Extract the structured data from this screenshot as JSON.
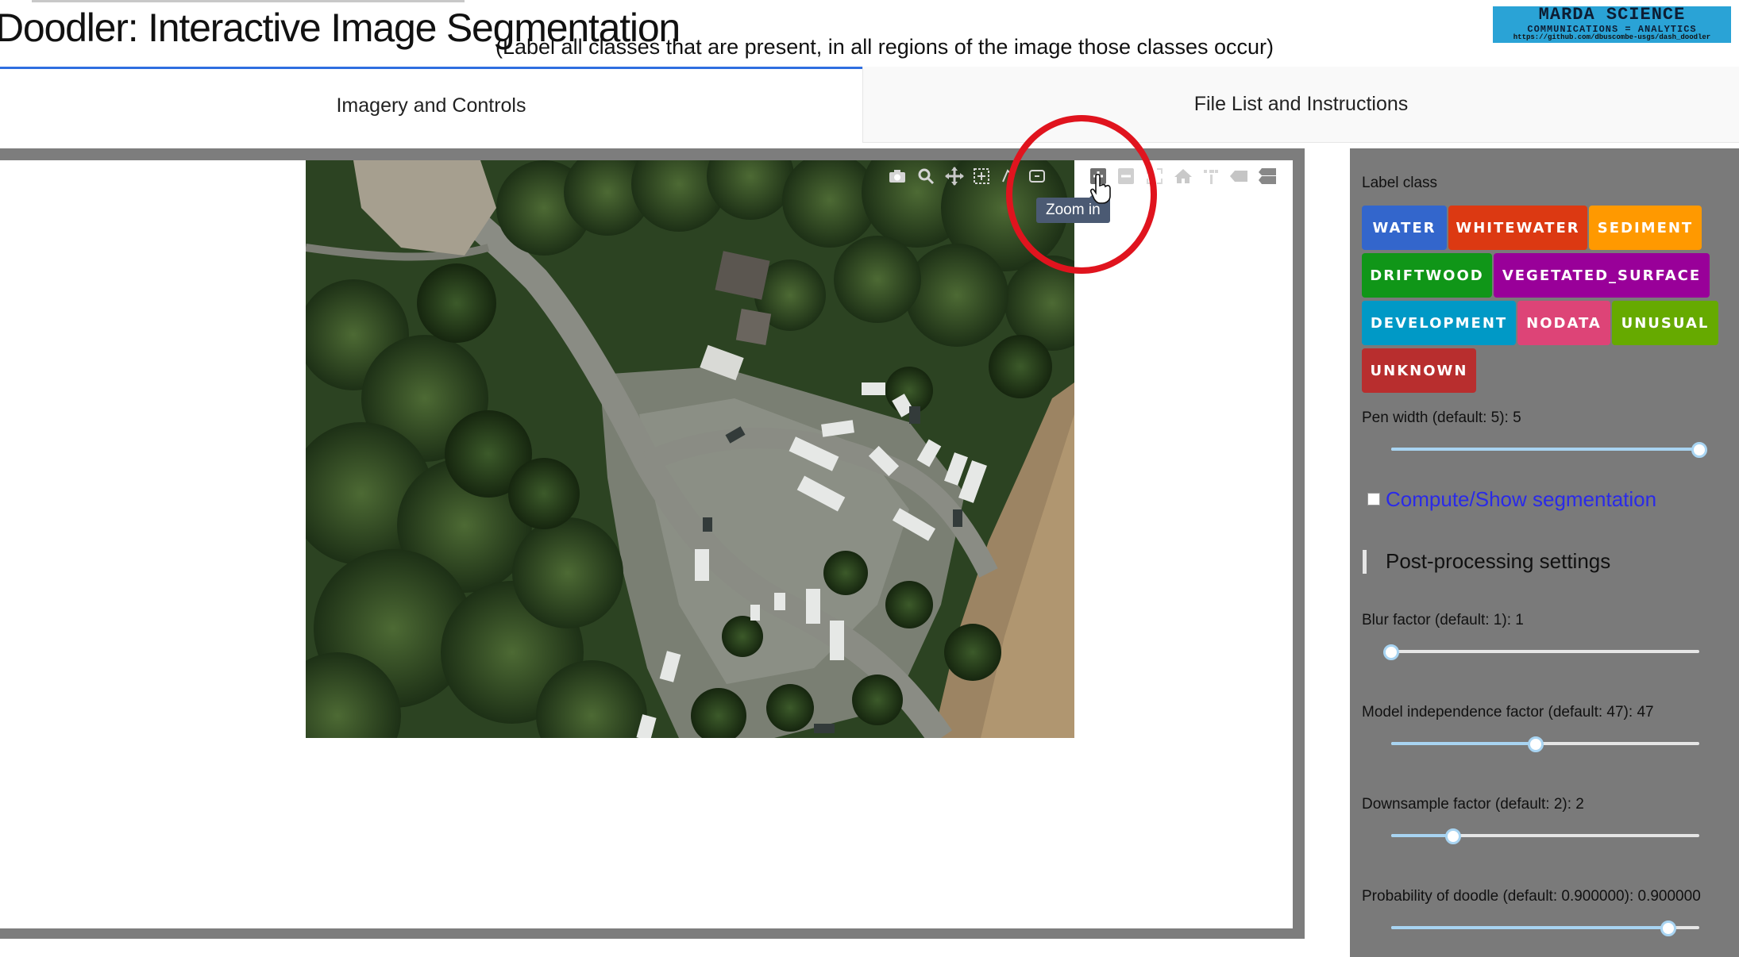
{
  "header": {
    "title": "Doodler: Interactive Image Segmentation",
    "subtitle": "(Label all classes that are present, in all regions of the image those classes occur)",
    "logo_line1": "MARDA SCIENCE",
    "logo_line2": "COMMUNICATIONS = ANALYTICS",
    "logo_url": "https://github.com/dbuscombe-usgs/dash_doodler"
  },
  "tabs": [
    {
      "label": "Imagery and Controls",
      "active": true
    },
    {
      "label": "File List and Instructions",
      "active": false
    }
  ],
  "modebar": {
    "icons": [
      "camera-icon",
      "zoom-icon",
      "pan-icon",
      "box-select-icon",
      "lasso-select-icon",
      "draw-open-path-icon",
      "zoom-in-icon",
      "zoom-out-icon",
      "autoscale-icon",
      "reset-axes-icon",
      "spike-lines-icon",
      "hover-closest-icon",
      "hover-compare-icon"
    ],
    "tooltip": "Zoom in"
  },
  "controls": {
    "label_class_heading": "Label class",
    "classes": [
      {
        "label": "WATER",
        "color": "#3366cc"
      },
      {
        "label": "WHITEWATER",
        "color": "#dc3912"
      },
      {
        "label": "SEDIMENT",
        "color": "#ff9900"
      },
      {
        "label": "DRIFTWOOD",
        "color": "#109618"
      },
      {
        "label": "VEGETATED_SURFACE",
        "color": "#990099"
      },
      {
        "label": "DEVELOPMENT",
        "color": "#0099c6"
      },
      {
        "label": "NODATA",
        "color": "#dd4477"
      },
      {
        "label": "UNUSUAL",
        "color": "#66aa00"
      },
      {
        "label": "UNKNOWN",
        "color": "#b82e2e"
      }
    ],
    "pen_width": {
      "label": "Pen width (default: 5): 5",
      "fraction": 1.0
    },
    "segmentation_checkbox": {
      "label": "Compute/Show segmentation",
      "checked": false
    },
    "post_processing_heading": "Post-processing settings",
    "blur": {
      "label": "Blur factor (default: 1): 1",
      "fraction": 0.0
    },
    "model_independence": {
      "label": "Model independence factor (default: 47): 47",
      "fraction": 0.47
    },
    "downsample": {
      "label": "Downsample factor (default: 2): 2",
      "fraction": 0.2
    },
    "probability": {
      "label": "Probability of doodle (default: 0.900000): 0.900000",
      "fraction": 0.9
    }
  }
}
